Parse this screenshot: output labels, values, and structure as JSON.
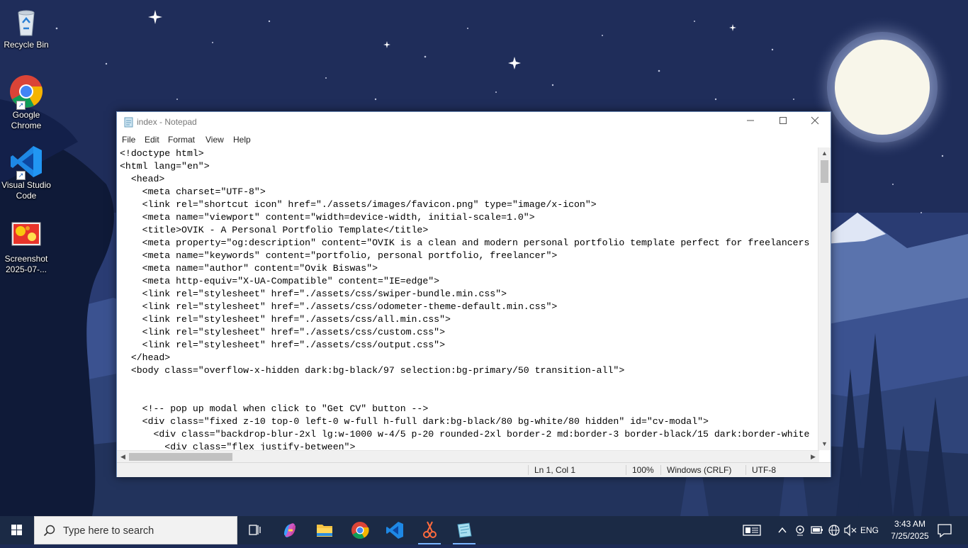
{
  "desktop": {
    "icons": [
      {
        "label": "Recycle Bin",
        "icon": "recycle-bin-icon"
      },
      {
        "label": "Google Chrome",
        "icon": "chrome-icon"
      },
      {
        "label": "Visual Studio Code",
        "icon": "vscode-icon"
      },
      {
        "label": "Screenshot 2025-07-...",
        "icon": "image-file-icon"
      }
    ]
  },
  "notepad": {
    "title": "index - Notepad",
    "menu": [
      "File",
      "Edit",
      "Format",
      "View",
      "Help"
    ],
    "lines": [
      "<!doctype html>",
      "<html lang=\"en\">",
      "  <head>",
      "    <meta charset=\"UTF-8\">",
      "    <link rel=\"shortcut icon\" href=\"./assets/images/favicon.png\" type=\"image/x-icon\">",
      "    <meta name=\"viewport\" content=\"width=device-width, initial-scale=1.0\">",
      "    <title>OVIK - A Personal Portfolio Template</title>",
      "    <meta property=\"og:description\" content=\"OVIK is a clean and modern personal portfolio template perfect for freelancers",
      "    <meta name=\"keywords\" content=\"portfolio, personal portfolio, freelancer\">",
      "    <meta name=\"author\" content=\"Ovik Biswas\">",
      "    <meta http-equiv=\"X-UA-Compatible\" content=\"IE=edge\">",
      "    <link rel=\"stylesheet\" href=\"./assets/css/swiper-bundle.min.css\">",
      "    <link rel=\"stylesheet\" href=\"./assets/css/odometer-theme-default.min.css\">",
      "    <link rel=\"stylesheet\" href=\"./assets/css/all.min.css\">",
      "    <link rel=\"stylesheet\" href=\"./assets/css/custom.css\">",
      "    <link rel=\"stylesheet\" href=\"./assets/css/output.css\">",
      "  </head>",
      "  <body class=\"overflow-x-hidden dark:bg-black/97 selection:bg-primary/50 transition-all\">",
      "",
      "",
      "    <!-- pop up modal when click to \"Get CV\" button -->",
      "    <div class=\"fixed z-10 top-0 left-0 w-full h-full dark:bg-black/80 bg-white/80 hidden\" id=\"cv-modal\">",
      "      <div class=\"backdrop-blur-2xl lg:w-1000 w-4/5 p-20 rounded-2xl border-2 md:border-3 border-black/15 dark:border-white",
      "        <div class=\"flex justify-between\">"
    ],
    "status": {
      "position": "Ln 1, Col 1",
      "zoom": "100%",
      "line_ending": "Windows (CRLF)",
      "encoding": "UTF-8"
    }
  },
  "taskbar": {
    "search_placeholder": "Type here to search",
    "apps": [
      "task-view-icon",
      "copilot-icon",
      "file-explorer-icon",
      "chrome-icon",
      "vscode-icon",
      "snipping-tool-icon",
      "notepad-icon"
    ],
    "language": "ENG",
    "time": "3:43 AM",
    "date": "7/25/2025"
  },
  "colors": {
    "taskbar": "#1b2a45",
    "active_underline": "#7ab6ff",
    "notepad_border": "#6d8bb8"
  }
}
